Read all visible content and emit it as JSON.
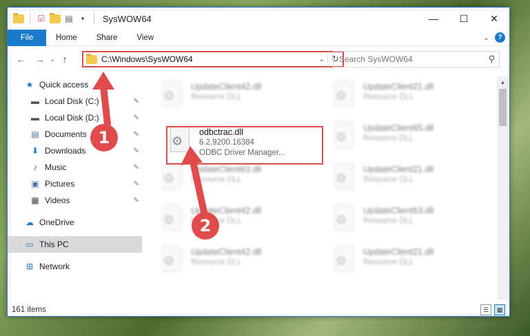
{
  "window": {
    "title": "SysWOW64",
    "controls": {
      "minimize": "—",
      "maximize": "☐",
      "close": "✕"
    }
  },
  "ribbon": {
    "tabs": [
      "File",
      "Home",
      "Share",
      "View"
    ],
    "expand_icon": "⌄",
    "help_label": "?"
  },
  "navigation": {
    "back": "←",
    "forward": "→",
    "recent": "⌄",
    "up": "↑",
    "address": "C:\\Windows\\SysWOW64",
    "search_placeholder": "Search SysWOW64"
  },
  "sidebar": {
    "items": [
      {
        "label": "Quick access",
        "icon": "★",
        "pinned": false
      },
      {
        "label": "Local Disk (C:)",
        "icon": "▬",
        "pinned": true
      },
      {
        "label": "Local Disk (D:)",
        "icon": "▬",
        "pinned": true
      },
      {
        "label": "Documents",
        "icon": "▤",
        "pinned": true
      },
      {
        "label": "Downloads",
        "icon": "⬇",
        "pinned": true
      },
      {
        "label": "Music",
        "icon": "♪",
        "pinned": true
      },
      {
        "label": "Pictures",
        "icon": "▣",
        "pinned": true
      },
      {
        "label": "Videos",
        "icon": "▦",
        "pinned": true
      },
      {
        "label": "OneDrive",
        "icon": "☁",
        "pinned": false
      },
      {
        "label": "This PC",
        "icon": "▭",
        "pinned": false
      },
      {
        "label": "Network",
        "icon": "⊞",
        "pinned": false
      }
    ],
    "pin_icon": "📌"
  },
  "files": {
    "highlighted": {
      "name": "odbctrac.dll",
      "version": "6.2.9200.16384",
      "description": "ODBC Driver Manager..."
    },
    "blurred": [
      {
        "name": "UpdateClient42.dll",
        "type": "Resource DLL"
      },
      {
        "name": "UpdateClient21.dll",
        "type": "Resource DLL"
      },
      {
        "name": "UpdateClient65.dll",
        "type": "Resource DLL"
      },
      {
        "name": "UpdateClient63.dll",
        "type": "Resource DLL"
      },
      {
        "name": "UpdateClient21.dll",
        "type": "Resource DLL"
      },
      {
        "name": "UpdateClient42.dll",
        "type": "Resource DLL"
      },
      {
        "name": "UpdateClient63.dll",
        "type": "Resource DLL"
      },
      {
        "name": "UpdateClient42.dll",
        "type": "Resource DLL"
      },
      {
        "name": "UpdateClient21.dll",
        "type": "Resource DLL"
      }
    ]
  },
  "status": {
    "item_count": "161 items"
  },
  "annotations": {
    "badge1": "1",
    "badge2": "2"
  },
  "colors": {
    "accent": "#1979ca",
    "highlight": "#e04a4a"
  }
}
